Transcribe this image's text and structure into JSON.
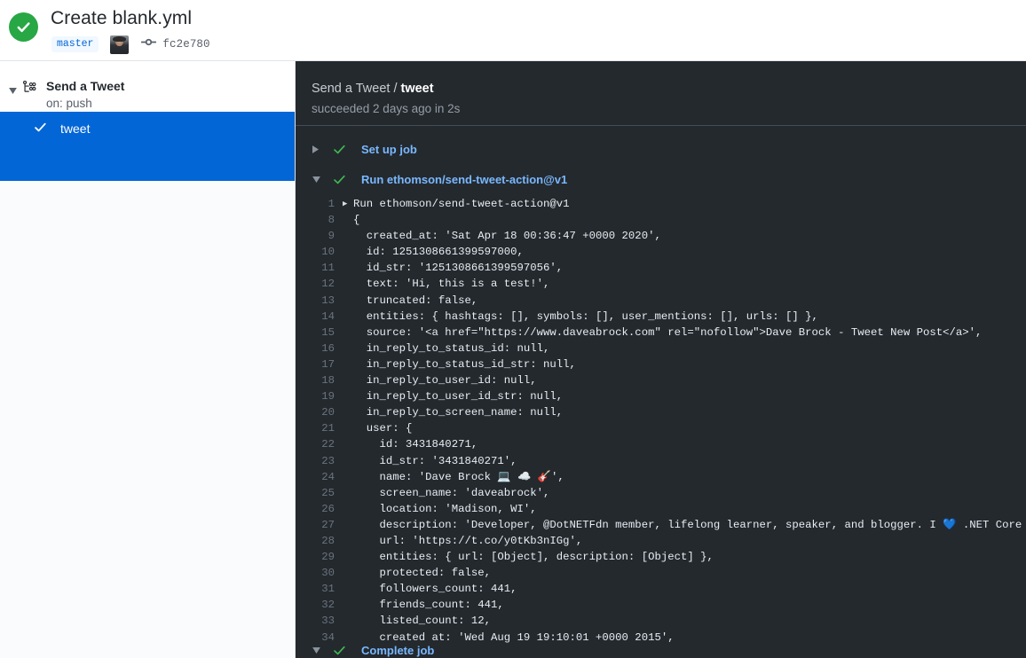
{
  "header": {
    "status_icon": "check-circle-icon",
    "status_color": "#28a745",
    "title": "Create blank.yml",
    "branch": "master",
    "avatar_alt": "daveabrock",
    "commit_icon": "commit-icon",
    "commit_sha": "fc2e780"
  },
  "sidebar": {
    "caret": "▼",
    "workflow_icon": "workflow-graph-icon",
    "workflow_name": "Send a Tweet",
    "workflow_trigger": "on: push",
    "job": {
      "check_icon": "check-icon",
      "label": "tweet",
      "selected_color": "#0366d6"
    }
  },
  "log": {
    "breadcrumb_parent": "Send a Tweet",
    "breadcrumb_sep": " / ",
    "breadcrumb_current": "tweet",
    "subtitle": "succeeded 2 days ago in 2s",
    "steps": [
      {
        "caret": "▶",
        "check_icon": "check-icon",
        "name": "Set up job",
        "expanded": false
      },
      {
        "caret": "▼",
        "check_icon": "check-icon",
        "name": "Run ethomson/send-tweet-action@v1",
        "expanded": true
      }
    ],
    "bottom_step": {
      "caret": "▼",
      "check_icon": "check-icon",
      "name": "Complete job"
    },
    "lines": [
      {
        "n": "1",
        "caret": "▶",
        "text": "Run ethomson/send-tweet-action@v1"
      },
      {
        "n": "8",
        "text": "{"
      },
      {
        "n": "9",
        "text": "  created_at: 'Sat Apr 18 00:36:47 +0000 2020',"
      },
      {
        "n": "10",
        "text": "  id: 1251308661399597000,"
      },
      {
        "n": "11",
        "text": "  id_str: '1251308661399597056',"
      },
      {
        "n": "12",
        "text": "  text: 'Hi, this is a test!',"
      },
      {
        "n": "13",
        "text": "  truncated: false,"
      },
      {
        "n": "14",
        "text": "  entities: { hashtags: [], symbols: [], user_mentions: [], urls: [] },"
      },
      {
        "n": "15",
        "text": "  source: '<a href=\"https://www.daveabrock.com\" rel=\"nofollow\">Dave Brock - Tweet New Post</a>',"
      },
      {
        "n": "16",
        "text": "  in_reply_to_status_id: null,"
      },
      {
        "n": "17",
        "text": "  in_reply_to_status_id_str: null,"
      },
      {
        "n": "18",
        "text": "  in_reply_to_user_id: null,"
      },
      {
        "n": "19",
        "text": "  in_reply_to_user_id_str: null,"
      },
      {
        "n": "20",
        "text": "  in_reply_to_screen_name: null,"
      },
      {
        "n": "21",
        "text": "  user: {"
      },
      {
        "n": "22",
        "text": "    id: 3431840271,"
      },
      {
        "n": "23",
        "text": "    id_str: '3431840271',"
      },
      {
        "n": "24",
        "text": "    name: 'Dave Brock 💻 ☁️ 🎸',"
      },
      {
        "n": "25",
        "text": "    screen_name: 'daveabrock',"
      },
      {
        "n": "26",
        "text": "    location: 'Madison, WI',"
      },
      {
        "n": "27",
        "text": "    description: 'Developer, @DotNETFdn member, lifelong learner, speaker, and blogger. I 💙 .NET Core and the cloud"
      },
      {
        "n": "28",
        "text": "    url: 'https://t.co/y0tKb3nIGg',"
      },
      {
        "n": "29",
        "text": "    entities: { url: [Object], description: [Object] },"
      },
      {
        "n": "30",
        "text": "    protected: false,"
      },
      {
        "n": "31",
        "text": "    followers_count: 441,"
      },
      {
        "n": "32",
        "text": "    friends_count: 441,"
      },
      {
        "n": "33",
        "text": "    listed_count: 12,"
      },
      {
        "n": "34",
        "text": "    created at: 'Wed Aug 19 19:10:01 +0000 2015',"
      }
    ]
  }
}
